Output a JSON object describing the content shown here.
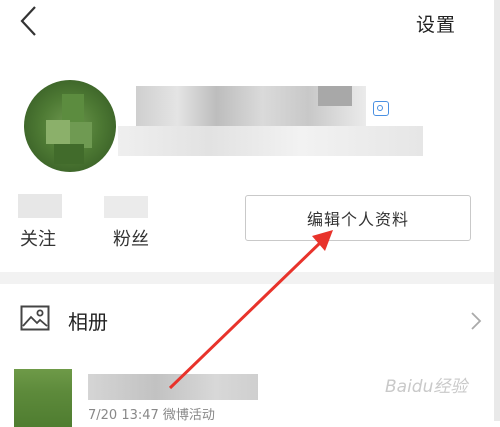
{
  "header": {
    "back_icon": "chevron-left-icon",
    "settings_label": "设置"
  },
  "profile": {
    "avatar": "avatar-image",
    "badge_icon": "camera-icon"
  },
  "stats": {
    "following_label": "关注",
    "fans_label": "粉丝"
  },
  "edit_profile_label": "编辑个人资料",
  "menu": {
    "album_label": "相册",
    "album_icon": "image-icon",
    "chevron_icon": "chevron-right-icon"
  },
  "activity": {
    "subtitle": "7/20 13:47 微博活动"
  },
  "watermark": "Baidu经验",
  "colors": {
    "accent": "#4a90e2",
    "arrow": "#e8332b",
    "divider": "#f2f2f2"
  }
}
